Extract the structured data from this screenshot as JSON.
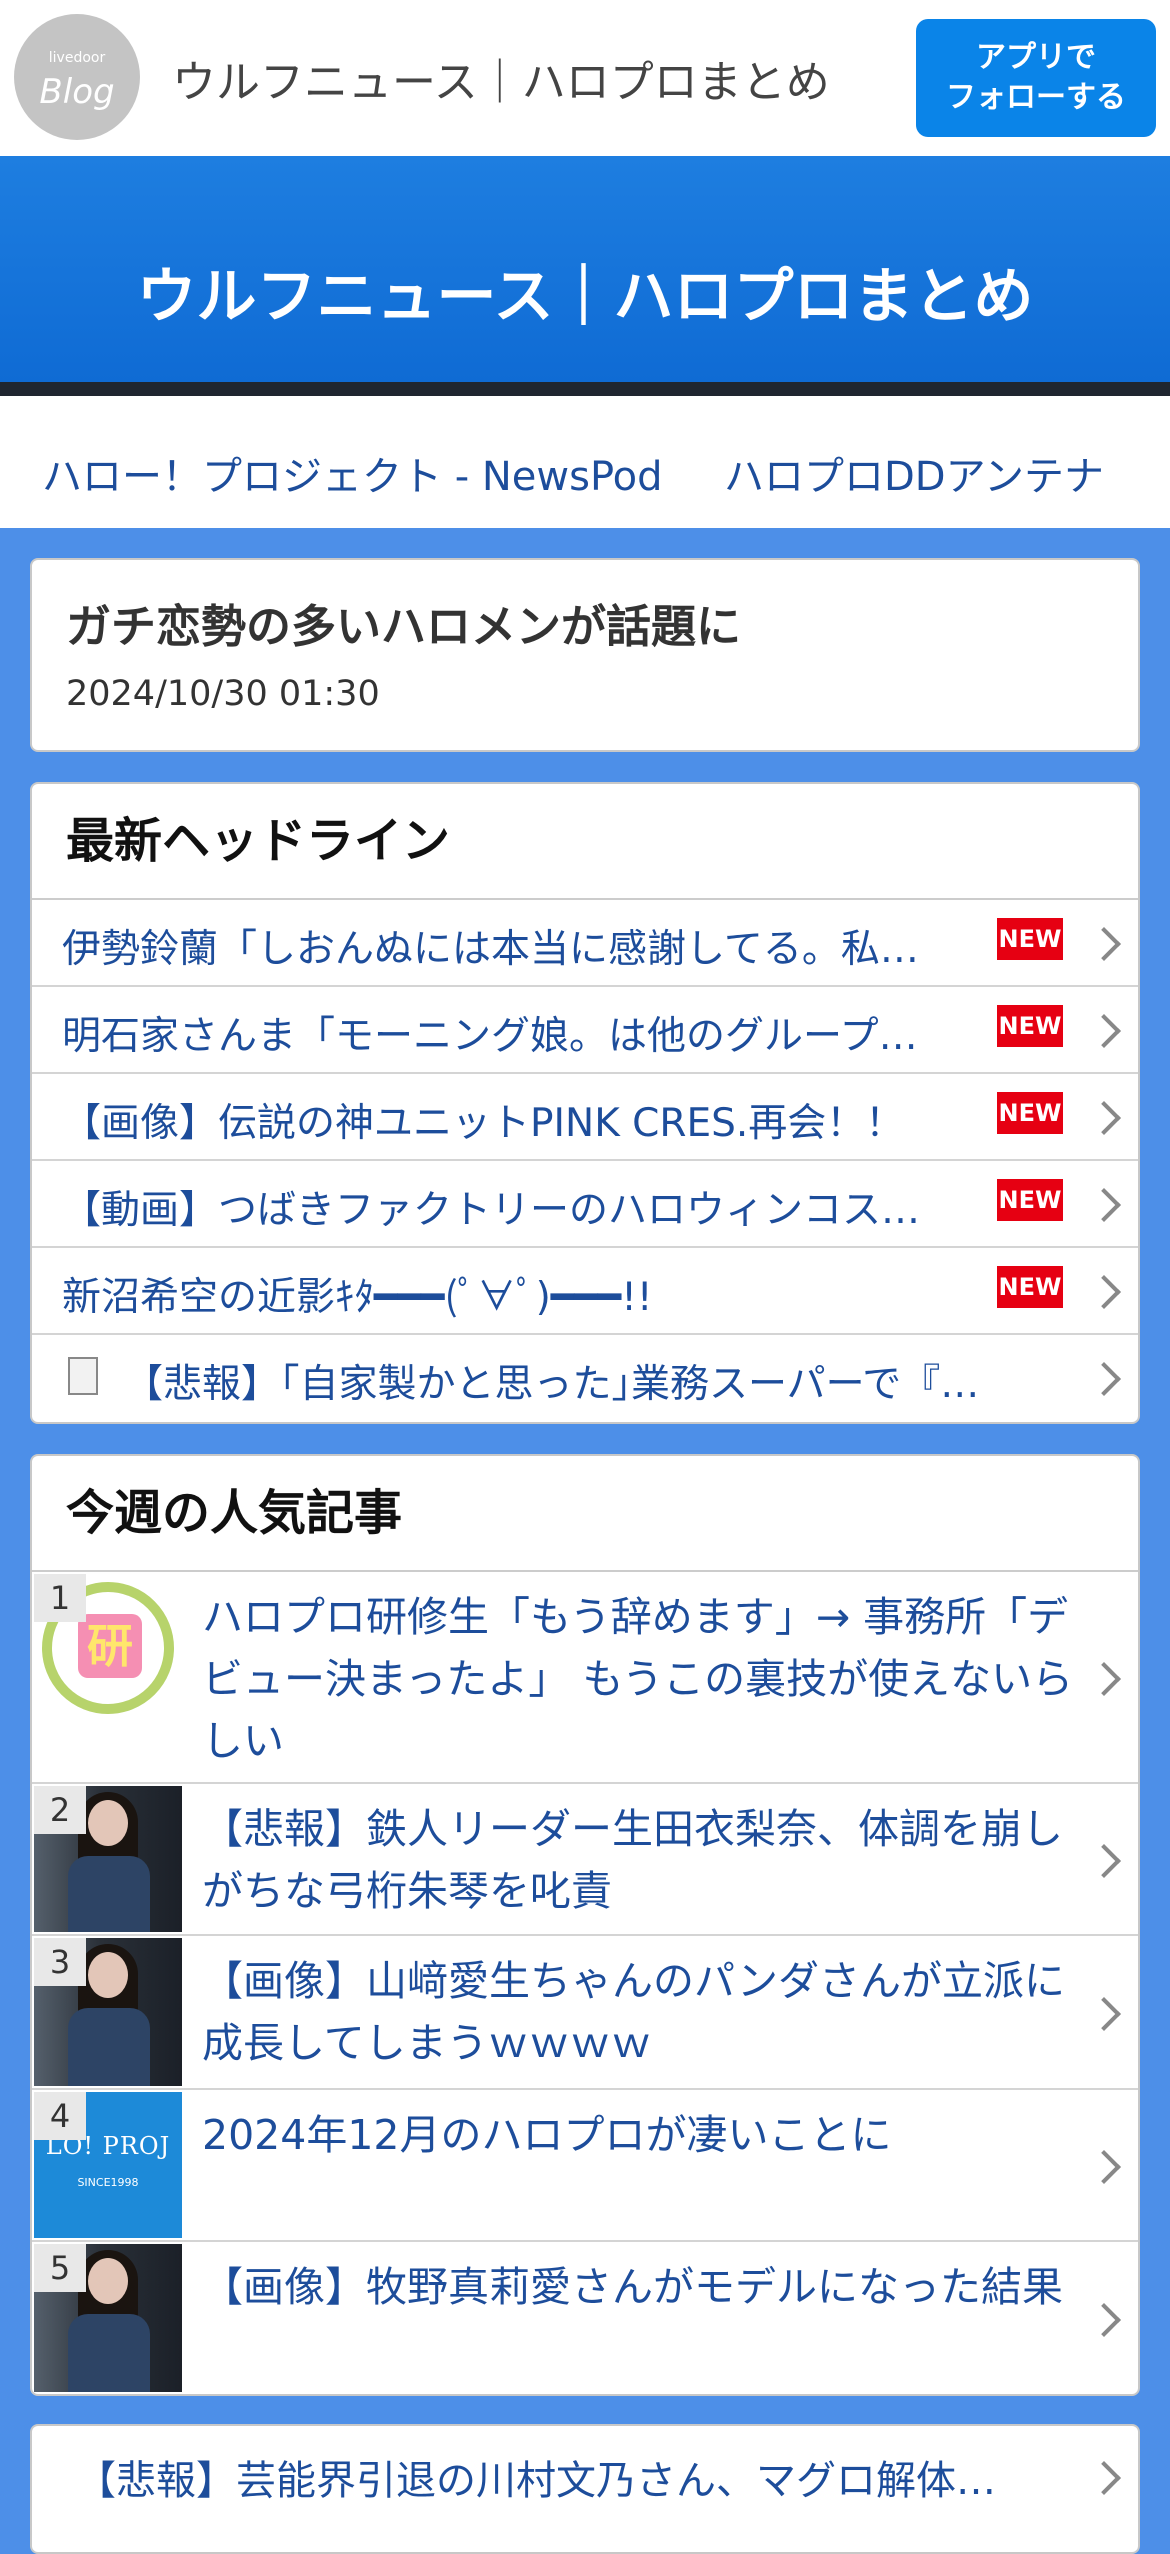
{
  "header": {
    "logo_small": "livedoor",
    "logo_big": "Blog",
    "site_title": "ウルフニュース｜ハロプロまとめ",
    "follow_button": "アプリで\nフォローする"
  },
  "banner": {
    "title": "ウルフニュース｜ハロプロまとめ"
  },
  "antenna_links": [
    "ハロー！プロジェクト - NewsPod",
    "ハロプロDDアンテナ"
  ],
  "article": {
    "title": "ガチ恋勢の多いハロメンが話題に",
    "date": "2024/10/30 01:30"
  },
  "headlines": {
    "section_title": "最新ヘッドライン",
    "new_badge": "NEW",
    "items": [
      {
        "text": "伊勢鈴蘭「しおんぬには本当に感謝してる。私…",
        "new": true
      },
      {
        "text": "明石家さんま「モーニング娘。は他のグループ…",
        "new": true
      },
      {
        "text": "【画像】伝説の神ユニットPINK CRES.再会！！",
        "new": true
      },
      {
        "text": "【動画】つばきファクトリーのハロウィンコス…",
        "new": true
      },
      {
        "text": "新沼希空の近影ｷﾀ━━━(ﾟ∀ﾟ)━━━!!",
        "new": true
      },
      {
        "text": "【悲報】｢自家製かと思った｣業務スーパーで『…",
        "new": false,
        "icon": "document-icon"
      }
    ]
  },
  "popular": {
    "section_title": "今週の人気記事",
    "items": [
      {
        "rank": "1",
        "text": "ハロプロ研修生「もう辞めます」→ 事務所「デビュー決まったよ」 もうこの裏技が使えないらしい",
        "thumb": "laurel",
        "thumb_text": "研"
      },
      {
        "rank": "2",
        "text": "【悲報】鉄人リーダー生田衣梨奈、体調を崩しがちな弓桁朱琴を叱責",
        "thumb": "photo"
      },
      {
        "rank": "3",
        "text": "【画像】山﨑愛生ちゃんのパンダさんが立派に成長してしまうｗｗｗｗ",
        "thumb": "photo"
      },
      {
        "rank": "4",
        "text": "2024年12月のハロプロが凄いことに",
        "thumb": "logo",
        "thumb_text": "LO! PROJ",
        "thumb_subtext": "SINCE1998"
      },
      {
        "rank": "5",
        "text": "【画像】牧野真莉愛さんがモデルになった結果",
        "thumb": "photo"
      }
    ]
  },
  "bottom_item": {
    "text": "【悲報】芸能界引退の川村文乃さん、マグロ解体…"
  }
}
